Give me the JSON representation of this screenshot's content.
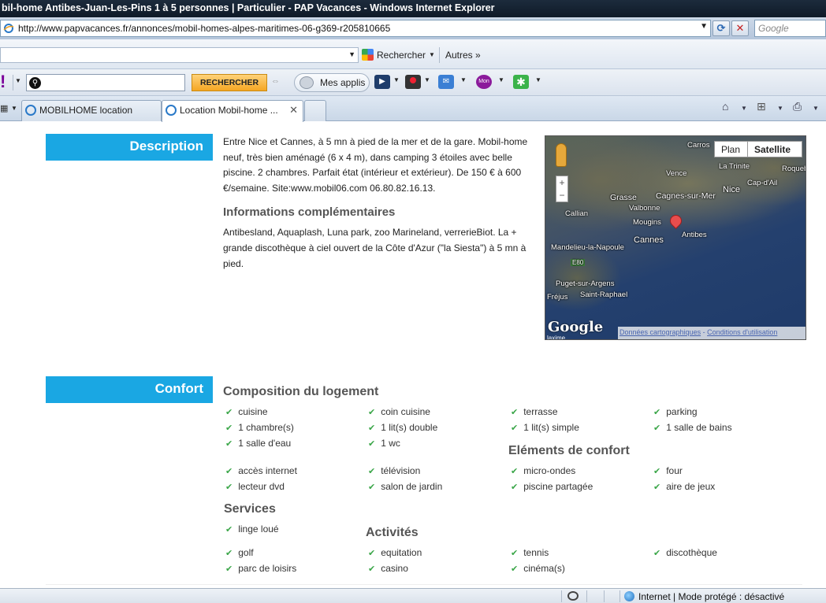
{
  "window": {
    "title": "bil-home Antibes-Juan-Les-Pins 1 à 5 personnes | Particulier - PAP Vacances - Windows Internet Explorer"
  },
  "address": {
    "url": "http://www.papvacances.fr/annonces/mobil-homes-alpes-maritimes-06-g369-r205810665",
    "search_placeholder": "Google"
  },
  "toolbar1": {
    "google_label": "Rechercher",
    "more_label": "Autres »"
  },
  "toolbar2": {
    "yahoo_logo": "!",
    "search_button": "RECHERCHER",
    "apps_label": "Mes applis",
    "icons": [
      "media-player-icon",
      "record-icon",
      "mail-icon",
      "mon-icon",
      "widget-icon"
    ]
  },
  "tabs": [
    {
      "label": "MOBILHOME location"
    },
    {
      "label": "Location Mobil-home ..."
    }
  ],
  "description": {
    "heading": "Description",
    "text": "Entre Nice et Cannes, à 5 mn à pied de la mer et de la gare. Mobil-home neuf, très bien aménagé (6 x 4 m), dans camping 3 étoiles avec belle piscine. 2 chambres. Parfait état (intérieur et extérieur). De 150 € à 600 €/semaine. Site:www.mobil06.com 06.80.82.16.13.",
    "info_heading": "Informations complémentaires",
    "info_text": "Antibesland, Aquaplash, Luna park, zoo Marineland, verrerieBiot. La + grande discothèque à ciel ouvert de la Côte d'Azur (\"la Siesta\") à 5 mn à pied."
  },
  "map": {
    "btn_plan": "Plan",
    "btn_satellite": "Satellite",
    "places": [
      "Carros",
      "La Trinite",
      "Roqueb",
      "Vence",
      "Cap-d'Ail",
      "Grasse",
      "Cagnes-sur-Mer",
      "Nice",
      "Valbonne",
      "Callian",
      "Mougins",
      "Antibes",
      "Cannes",
      "Mandelieu-la-Napoule",
      "E80",
      "Puget-sur-Argens",
      "Fréjus",
      "Saint-Raphael"
    ],
    "google_logo": "Google",
    "attribution_data": "Données cartographiques",
    "attribution_sep": " - ",
    "attribution_terms": "Conditions d'utilisation",
    "corner_text": "laxime"
  },
  "confort": {
    "heading": "Confort",
    "composition_title": "Composition du logement",
    "composition": [
      "cuisine",
      "coin cuisine",
      "terrasse",
      "parking",
      "1 chambre(s)",
      "1 lit(s) double",
      "1 lit(s) simple",
      "1 salle de bains",
      "1 salle d'eau",
      "1 wc"
    ],
    "elements_title": "Eléments de confort",
    "elements": [
      "accès internet",
      "télévision",
      "micro-ondes",
      "four",
      "lecteur dvd",
      "salon de jardin",
      "piscine partagée",
      "aire de jeux"
    ],
    "services_title": "Services",
    "services": [
      "linge loué"
    ],
    "activites_title": "Activités",
    "activites": [
      "golf",
      "equitation",
      "tennis",
      "discothèque",
      "parc de loisirs",
      "casino",
      "cinéma(s)"
    ]
  },
  "status": {
    "zone": "Internet | Mode protégé : désactivé"
  }
}
